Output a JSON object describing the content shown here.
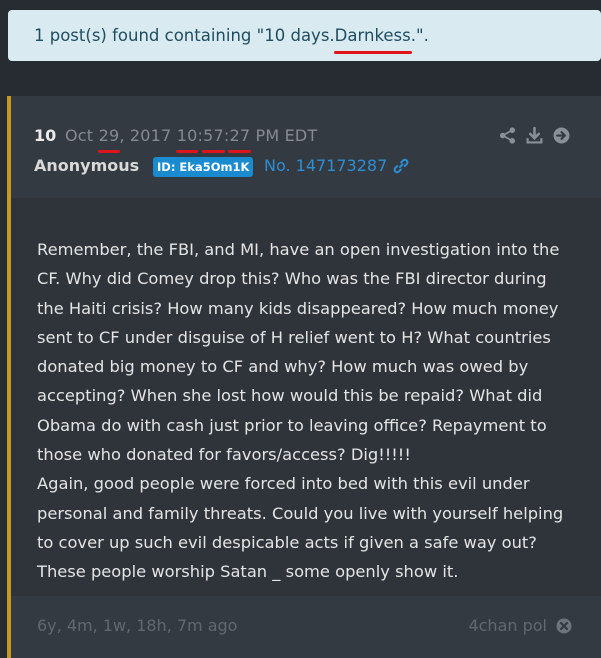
{
  "notice": {
    "prefix": "1 post(s) found containing \"10 days. ",
    "highlight": "Darnkess",
    "suffix": ".\"."
  },
  "post": {
    "number": "10",
    "date_parts": [
      "Oct ",
      "29",
      ", 2017 ",
      "10",
      ":",
      "57",
      ":",
      "27",
      " PM EDT"
    ],
    "author": "Anonymous",
    "id_badge": "ID: Eka5Om1K",
    "post_number": "No. 147173287",
    "body": [
      "Remember, the FBI, and MI, have an open investigation into the CF. Why did Comey drop this? Who was the FBI director during the Haiti crisis? How many kids disappeared? How much money sent to CF under disguise of H relief went to H? What countries donated big money to CF and why? How much was owed by accepting? When she lost how would this be repaid? What did Obama do with cash just prior to leaving office? Repayment to those who donated for favors/access? Dig!!!!!",
      "Again, good people were forced into bed with this evil under personal and family threats. Could you live with yourself helping to cover up such evil despicable acts if given a safe way out? These people worship Satan _ some openly show it."
    ],
    "time_ago": "6y, 4m, 1w, 18h, 7m ago",
    "source": "4chan pol"
  },
  "icons": [
    "share-icon",
    "download-icon",
    "arrow-right-circle-icon",
    "link-icon",
    "close-circle-icon"
  ],
  "colors": {
    "background": "#272c33",
    "notice_bg": "#daeaf1",
    "accent_border": "#c6991f",
    "link_blue": "#2d8ed4",
    "underline_red": "#e0141b"
  }
}
